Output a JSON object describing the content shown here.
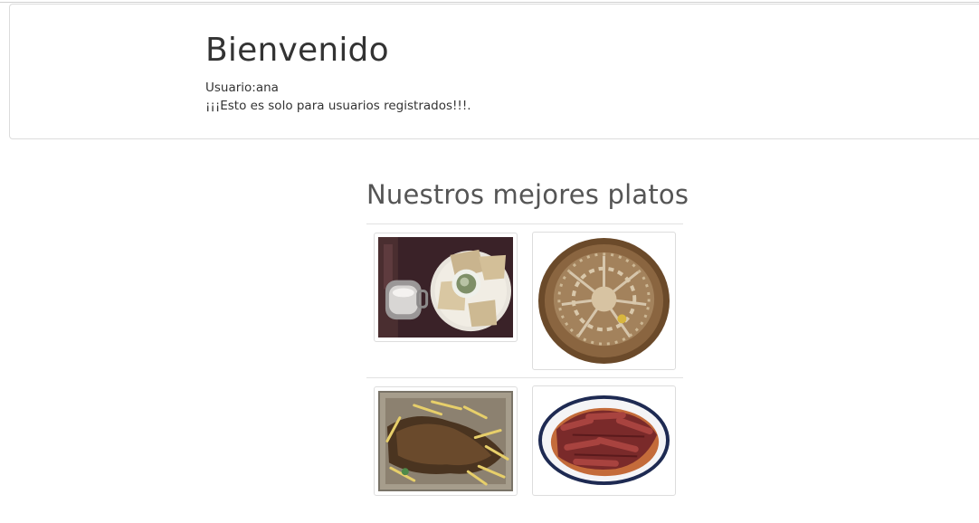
{
  "header": {
    "title": "Bienvenido",
    "user_line": "Usuario:ana",
    "notice": "¡¡¡Esto es solo para usuarios registrados!!!."
  },
  "gallery": {
    "title": "Nuestros mejores platos",
    "dishes": [
      {
        "image": "breakfast-plate-photo"
      },
      {
        "image": "round-bread-photo"
      },
      {
        "image": "roast-with-fries-photo"
      },
      {
        "image": "grilled-ribs-photo"
      }
    ]
  }
}
